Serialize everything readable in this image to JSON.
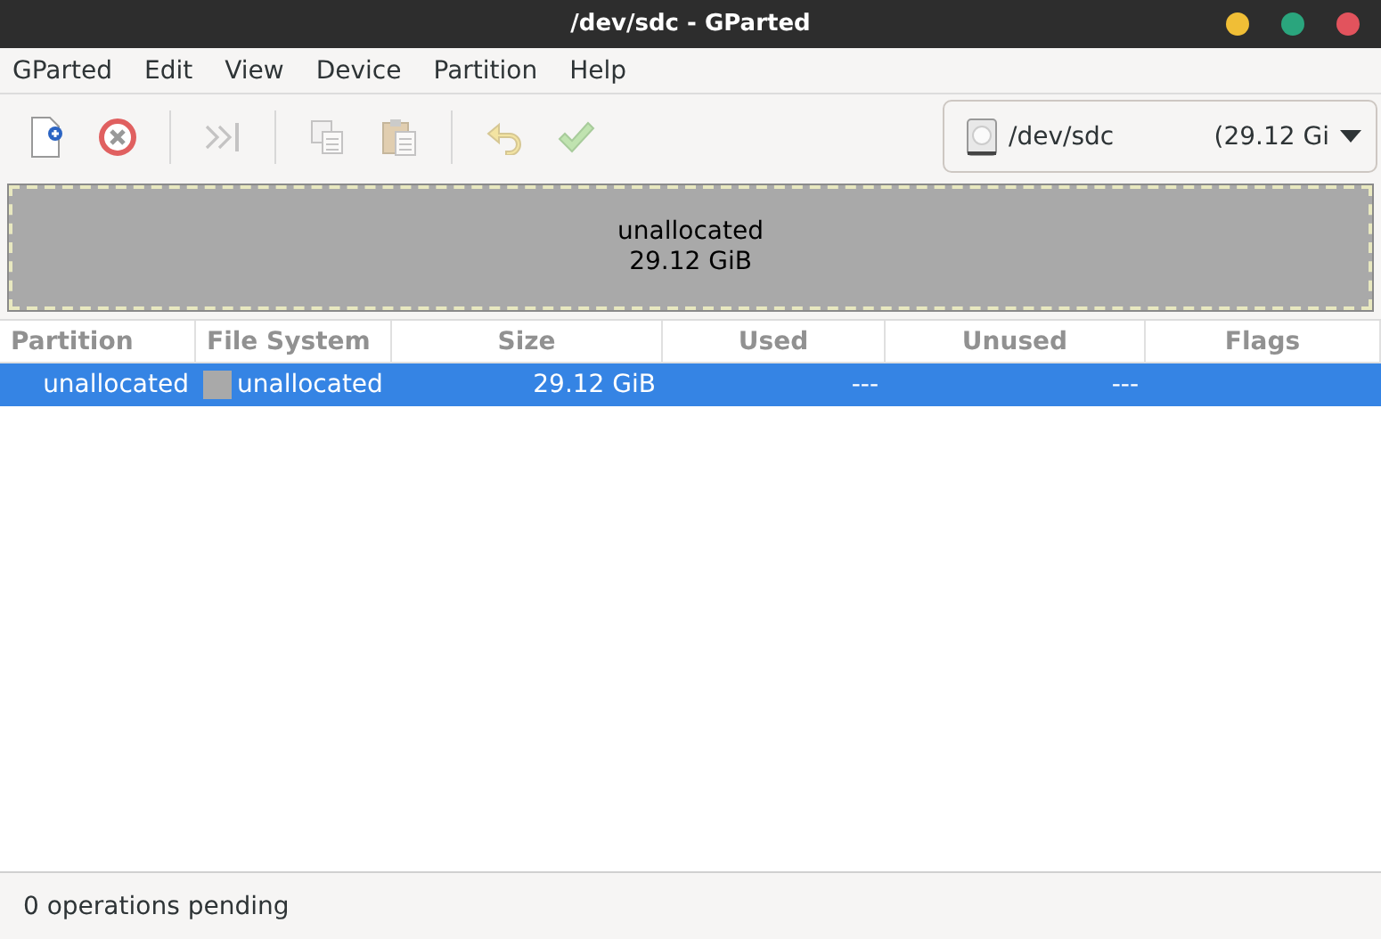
{
  "window": {
    "title": "/dev/sdc - GParted"
  },
  "menu": [
    "GParted",
    "Edit",
    "View",
    "Device",
    "Partition",
    "Help"
  ],
  "toolbar": [
    {
      "kind": "new",
      "disabled": false
    },
    {
      "kind": "delete",
      "disabled": false
    },
    {
      "kind": "sep"
    },
    {
      "kind": "resize",
      "disabled": true
    },
    {
      "kind": "sep"
    },
    {
      "kind": "copy",
      "disabled": true
    },
    {
      "kind": "paste",
      "disabled": true
    },
    {
      "kind": "sep"
    },
    {
      "kind": "undo",
      "disabled": true
    },
    {
      "kind": "apply",
      "disabled": true
    }
  ],
  "device": {
    "name": "/dev/sdc",
    "size": "(29.12 Gi"
  },
  "disk_map": {
    "label": "unallocated",
    "size": "29.12 GiB"
  },
  "table": {
    "columns": [
      "Partition",
      "File System",
      "Size",
      "Used",
      "Unused",
      "Flags"
    ],
    "rows": [
      {
        "selected": true,
        "partition": "unallocated",
        "filesystem": "unallocated",
        "size": "29.12 GiB",
        "used": "---",
        "unused": "---",
        "flags": ""
      }
    ]
  },
  "status_bar": "0 operations pending"
}
